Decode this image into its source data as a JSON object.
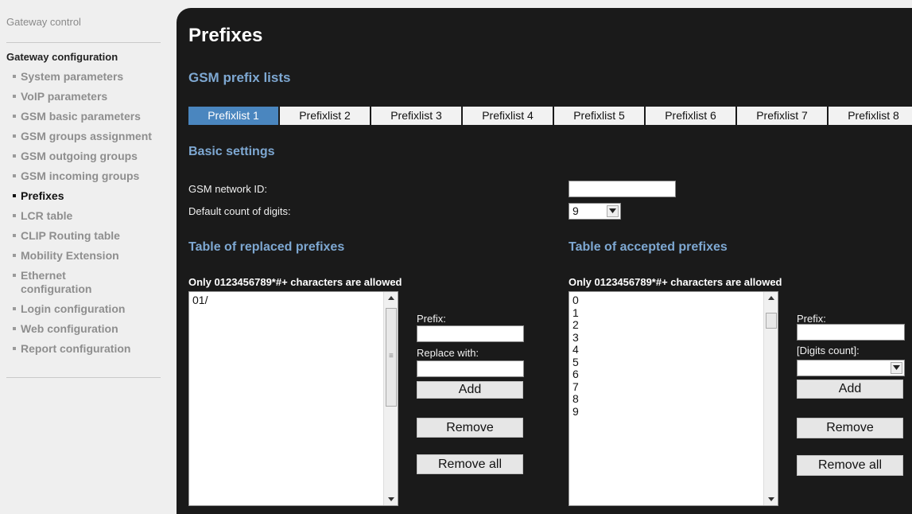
{
  "sidebar": {
    "top_link": "Gateway control",
    "section_title": "Gateway configuration",
    "items": [
      {
        "label": "System parameters"
      },
      {
        "label": "VoIP parameters"
      },
      {
        "label": "GSM basic parameters"
      },
      {
        "label": "GSM groups assignment"
      },
      {
        "label": "GSM outgoing groups"
      },
      {
        "label": "GSM incoming groups"
      },
      {
        "label": "Prefixes",
        "active": true
      },
      {
        "label": "LCR table"
      },
      {
        "label": "CLIP Routing table"
      },
      {
        "label": "Mobility Extension"
      },
      {
        "label": "Ethernet configuration"
      },
      {
        "label": "Login configuration"
      },
      {
        "label": "Web configuration"
      },
      {
        "label": "Report configuration"
      }
    ]
  },
  "main": {
    "title": "Prefixes",
    "subtitle": "GSM prefix lists",
    "tabs": [
      "Prefixlist 1",
      "Prefixlist 2",
      "Prefixlist 3",
      "Prefixlist 4",
      "Prefixlist 5",
      "Prefixlist 6",
      "Prefixlist 7",
      "Prefixlist 8"
    ],
    "active_tab": 0,
    "basic": {
      "title": "Basic settings",
      "network_id_label": "GSM network ID:",
      "network_id_value": "",
      "digits_label": "Default count of digits:",
      "digits_value": "9"
    },
    "replaced": {
      "title": "Table of replaced prefixes",
      "hint": "Only 0123456789*#+ characters are allowed",
      "items": [
        "01/"
      ],
      "prefix_label": "Prefix:",
      "prefix_value": "",
      "replace_label": "Replace with:",
      "replace_value": "",
      "add": "Add",
      "remove": "Remove",
      "remove_all": "Remove all"
    },
    "accepted": {
      "title": "Table of accepted prefixes",
      "hint": "Only 0123456789*#+ characters are allowed",
      "items": [
        "0",
        "1",
        "2",
        "3",
        "4",
        "5",
        "6",
        "7",
        "8",
        "9"
      ],
      "prefix_label": "Prefix:",
      "prefix_value": "",
      "digits_label": "[Digits count]:",
      "digits_value": "",
      "add": "Add",
      "remove": "Remove",
      "remove_all": "Remove all"
    }
  },
  "colors": {
    "accent_blue": "#7ea8d2",
    "tab_active": "#4a86bf",
    "panel_bg": "#1a1a1a",
    "sidebar_bg": "#efefef"
  }
}
